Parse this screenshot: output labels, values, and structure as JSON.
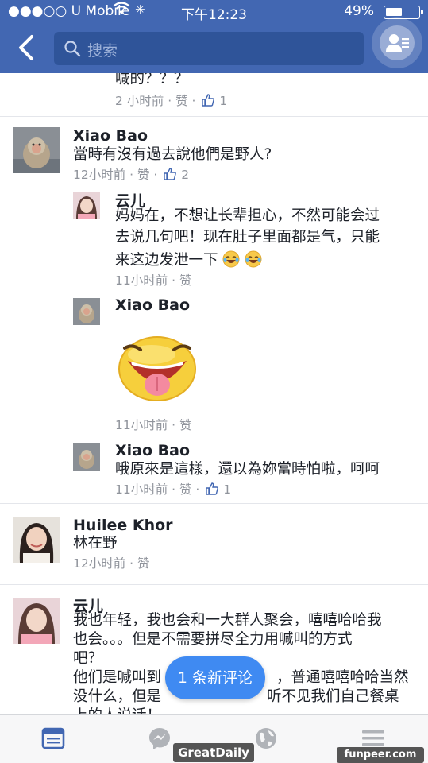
{
  "status_bar": {
    "carrier": "●●●○○ U Mobile",
    "time": "下午12:23",
    "battery": "49%",
    "battery_level": 0.49
  },
  "header": {
    "search_placeholder": "搜索"
  },
  "comments": [
    {
      "id": "c0",
      "text": "喊的？？？",
      "meta": "2 小时前 · 赞 ·",
      "likes": "1"
    },
    {
      "id": "c1",
      "name": "Xiao Bao",
      "text": "當時有沒有過去說他們是野人?",
      "meta": "12小时前 · 赞 ·",
      "likes": "2"
    },
    {
      "id": "c1r1",
      "name": "云儿",
      "text_lines": [
        "妈妈在，不想让长辈担心，不然可能会过",
        "去说几句吧！现在肚子里面都是气，只能",
        "来这边发泄一下"
      ],
      "emojis": [
        "tears-of-joy-emoji",
        "tears-of-joy-emoji"
      ],
      "meta": "11小时前 · 赞"
    },
    {
      "id": "c1r2",
      "name": "Xiao Bao",
      "sticker": "tongue-out-sticker",
      "meta": "11小时前 · 赞"
    },
    {
      "id": "c1r3",
      "name": "Xiao Bao",
      "text": "哦原來是這樣，還以為妳當時怕啦，呵呵",
      "meta": "11小时前 · 赞 ·",
      "likes": "1"
    },
    {
      "id": "c2",
      "name": "Huilee Khor",
      "text": "林在野",
      "meta": "12小时前 · 赞"
    },
    {
      "id": "c3",
      "name": "云儿",
      "text_lines": [
        "我也年轻，我也会和一大群人聚会，嘻嘻哈哈我",
        "也会。。。但是不需要拼尽全力用喊叫的方式",
        "吧？",
        "他们是喊叫到",
        "没什么，但是",
        "上的人说话！"
      ],
      "text_tail": [
        "，普通嘻嘻哈哈当然",
        "听不见我们自己餐桌"
      ]
    }
  ],
  "new_comments_pill": "1 条新评论",
  "tabs": [
    "feed-tab",
    "messenger-tab",
    "globe-tab",
    "menu-tab"
  ],
  "watermarks": [
    "GreatDaily",
    "funpeer.com"
  ],
  "colors": {
    "header": "#4267b2",
    "link_blue": "#4267b2",
    "pill": "#3f8af2",
    "meta_gray": "#90949c"
  }
}
